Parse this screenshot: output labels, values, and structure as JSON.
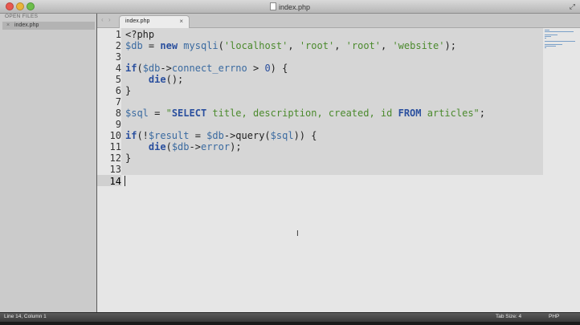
{
  "window": {
    "title": "index.php"
  },
  "sidebar": {
    "header": "OPEN FILES",
    "files": [
      {
        "label": "index.php"
      }
    ]
  },
  "tabs": [
    {
      "label": "index.php"
    }
  ],
  "editor": {
    "line_numbers": [
      "1",
      "2",
      "3",
      "4",
      "5",
      "6",
      "7",
      "8",
      "9",
      "10",
      "11",
      "12",
      "13",
      "14"
    ],
    "current_line": 14
  },
  "status": {
    "position": "Line 14, Column 1",
    "tab_size": "Tab Size: 4",
    "syntax": "PHP"
  },
  "colors": {
    "keyword": "#2a4f9e",
    "variable": "#3a6aa0",
    "string": "#4b8a2d",
    "editor_bg": "#e6e6e6",
    "selection": "#d6d6d6"
  }
}
